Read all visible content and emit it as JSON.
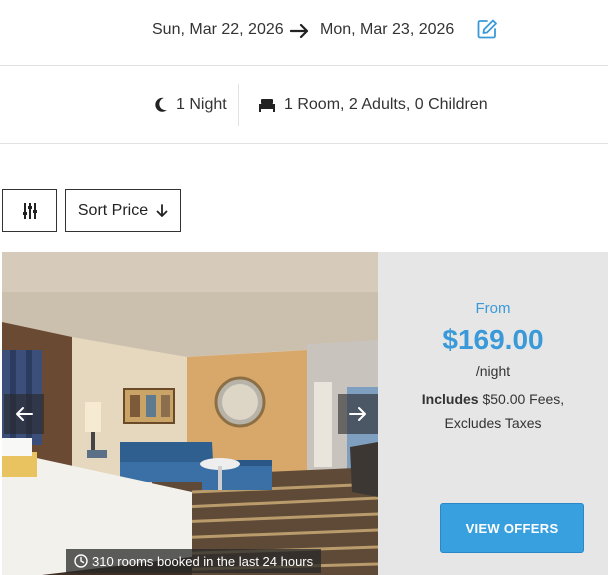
{
  "dates": {
    "check_in": "Sun, Mar 22, 2026",
    "check_out": "Mon, Mar 23, 2026",
    "arrow_icon": "arrow-right-icon",
    "edit_icon": "edit-icon"
  },
  "stay": {
    "nights": "1 Night",
    "guests": "1 Room, 2 Adults, 0 Children",
    "nights_icon": "moon-icon",
    "guests_icon": "bed-icon"
  },
  "toolbar": {
    "filter_icon": "sliders-icon",
    "sort_label": "Sort Price",
    "sort_icon": "arrow-down-icon"
  },
  "room": {
    "booked_text": "310 rooms booked in the last 24 hours",
    "prev_icon": "arrow-left-icon",
    "next_icon": "arrow-right-icon"
  },
  "offer": {
    "from_label": "From",
    "price": "$169.00",
    "per_night": "/night",
    "includes_label": "Includes",
    "fees_text": " $50.00 Fees,",
    "taxes_text": "Excludes Taxes",
    "button_label": "VIEW OFFERS"
  },
  "colors": {
    "accent": "#3a9ad9",
    "button": "#39a0e0",
    "panel": "#e6e6e6"
  }
}
